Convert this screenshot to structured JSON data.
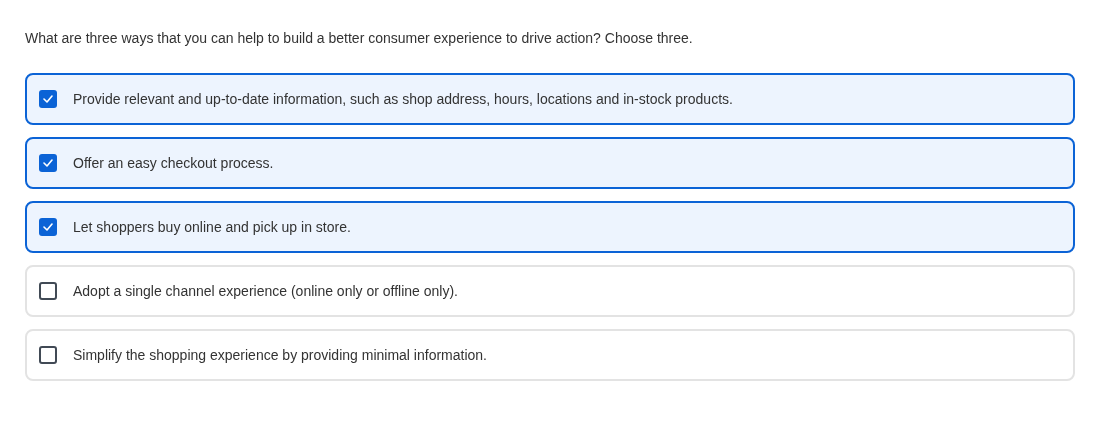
{
  "question": "What are three ways that you can help to build a better consumer experience to drive action? Choose three.",
  "options": [
    {
      "label": "Provide relevant and up-to-date information, such as shop address, hours, locations and in-stock products.",
      "checked": true
    },
    {
      "label": "Offer an easy checkout process.",
      "checked": true
    },
    {
      "label": "Let shoppers buy online and pick up in store.",
      "checked": true
    },
    {
      "label": "Adopt a single channel experience (online only or offline only).",
      "checked": false
    },
    {
      "label": "Simplify the shopping experience by providing minimal information.",
      "checked": false
    }
  ]
}
